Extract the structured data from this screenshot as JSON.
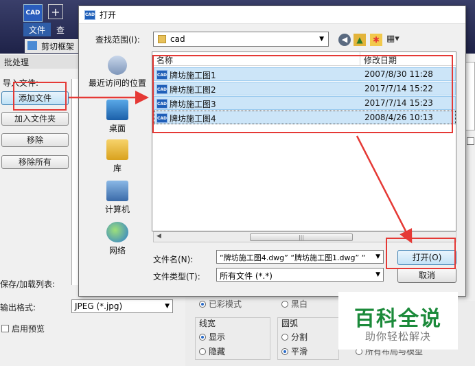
{
  "background_app": {
    "file_menu": "文件",
    "check_menu": "查",
    "cut_frame": "剪切框架",
    "batch_title": "批处理",
    "import_label": "导入文件:",
    "add_file": "添加文件",
    "add_folder": "加入文件夹",
    "remove": "移除",
    "remove_all": "移除所有",
    "save_load_list": "保存/加载列表:",
    "output_format_label": "输出格式:",
    "output_format_value": "JPEG (*.jpg)",
    "enable_preview": "启用预览",
    "line_width": {
      "title": "线宽",
      "show": "显示",
      "hide": "隐藏"
    },
    "arc": {
      "title": "圆弧",
      "split": "分割",
      "smooth": "平滑"
    },
    "partial_texts": [
      "已彩模式",
      "黑白",
      "所有布局与模型"
    ]
  },
  "dialog": {
    "title": "打开",
    "look_in_label": "查找范围(I):",
    "look_in_value": "cad",
    "places": [
      "最近访问的位置",
      "桌面",
      "库",
      "计算机",
      "网络"
    ],
    "columns": {
      "name": "名称",
      "date": "修改日期"
    },
    "files": [
      {
        "name": "牌坊施工图1",
        "date": "2007/8/30 11:28"
      },
      {
        "name": "牌坊施工图2",
        "date": "2017/7/14 15:22"
      },
      {
        "name": "牌坊施工图3",
        "date": "2017/7/14 15:23"
      },
      {
        "name": "牌坊施工图4",
        "date": "2008/4/26 10:13"
      }
    ],
    "file_name_label": "文件名(N):",
    "file_name_value": "“牌坊施工图4.dwg” “牌坊施工图1.dwg” “",
    "file_type_label": "文件类型(T):",
    "file_type_value": "所有文件 (*.*)",
    "open_button": "打开(O)",
    "cancel_button": "取消"
  },
  "watermark": {
    "title": "百科全说",
    "subtitle": "助你轻松解决"
  },
  "colors": {
    "highlight": "#e53935",
    "selection": "#cce5f8",
    "accent": "#1b8a3a"
  }
}
